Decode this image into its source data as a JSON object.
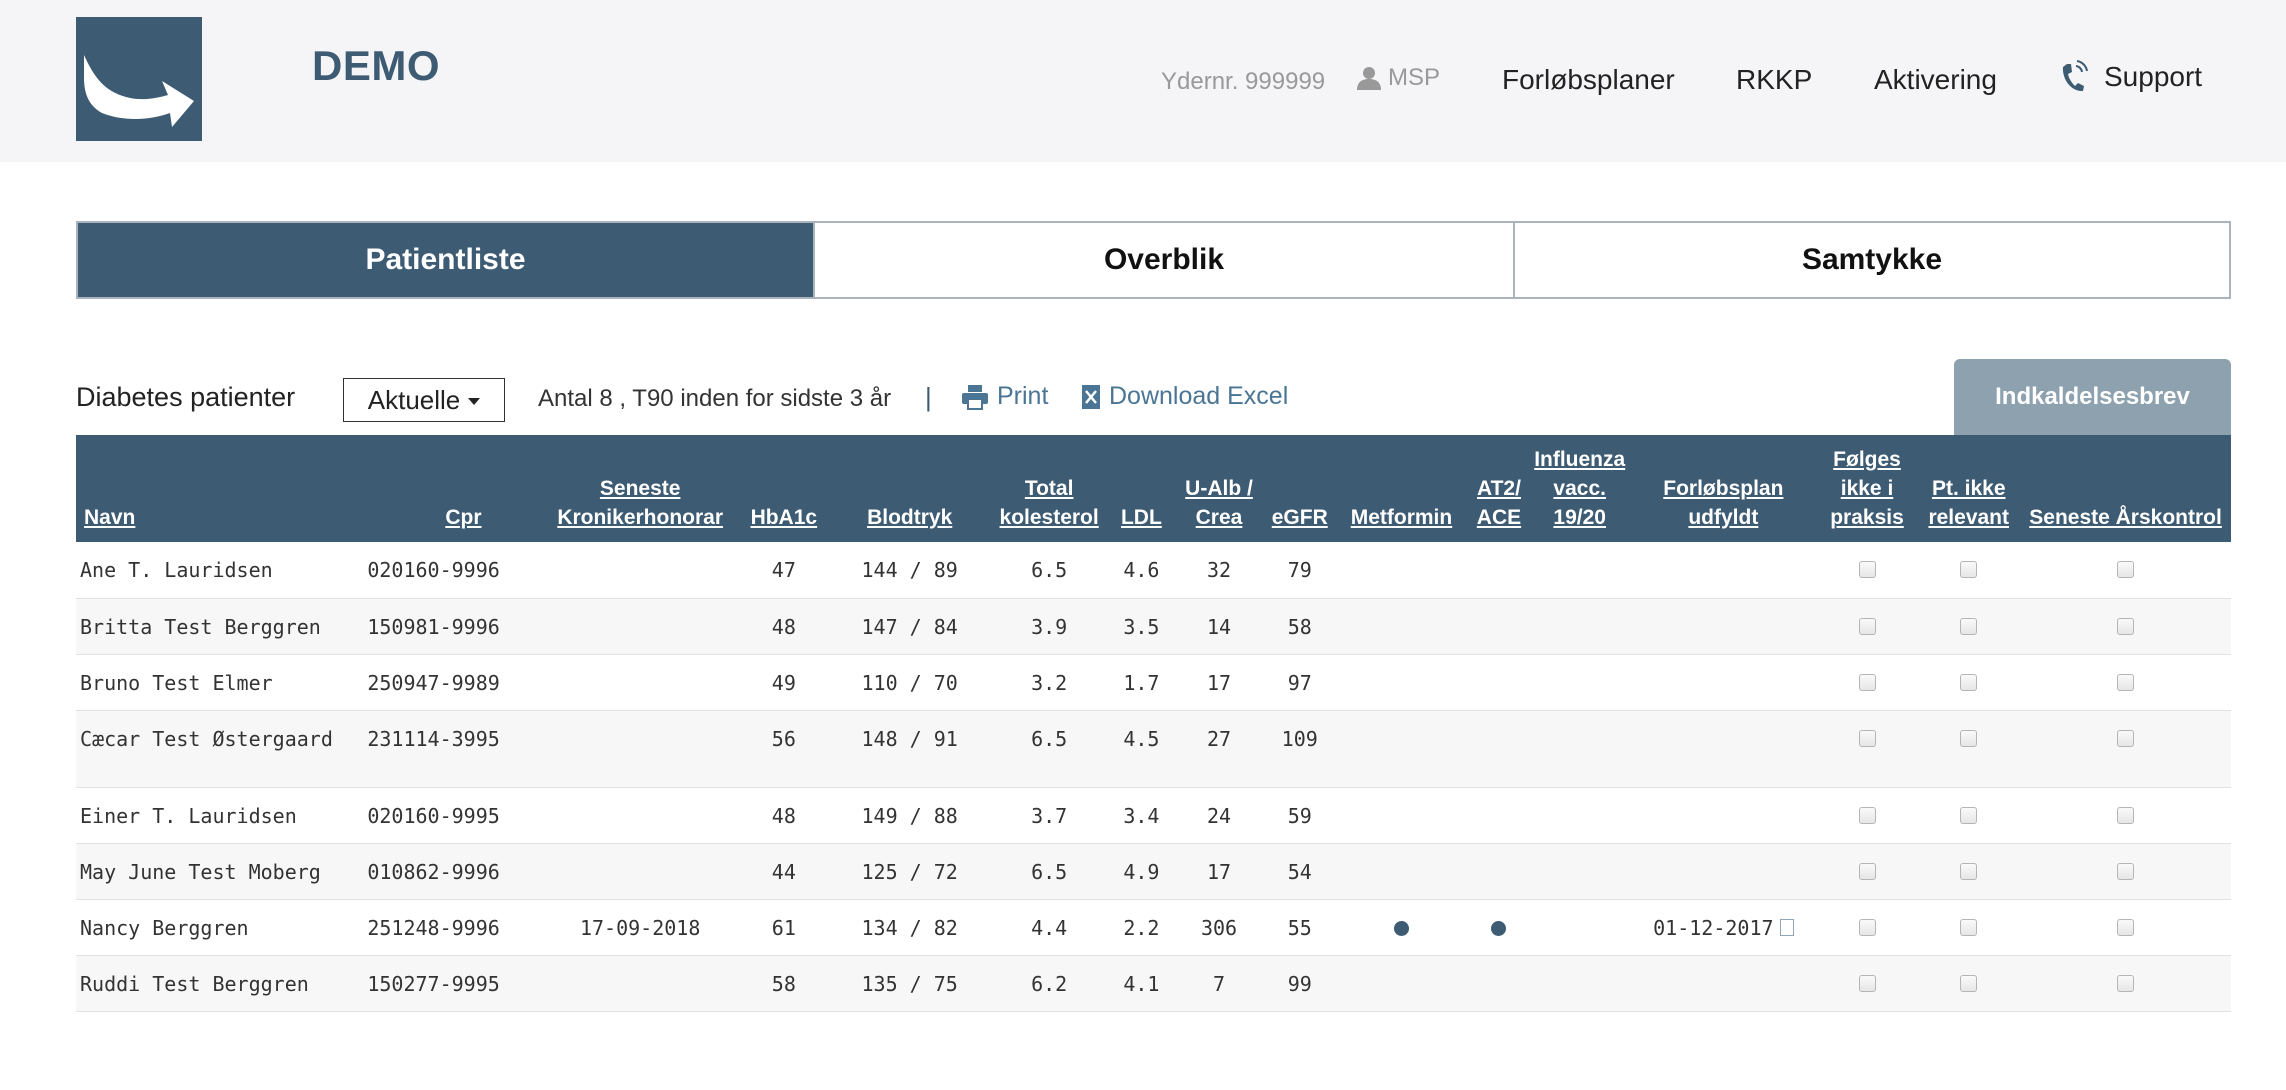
{
  "header": {
    "brand": "DEMO",
    "ydernr": "Ydernr. 999999",
    "user": "MSP",
    "nav": [
      "Forløbsplaner",
      "RKKP",
      "Aktivering"
    ],
    "support": "Support"
  },
  "tabs": [
    "Patientliste",
    "Overblik",
    "Samtykke"
  ],
  "toolbar": {
    "label": "Diabetes patienter",
    "filter_value": "Aktuelle",
    "count_text": "Antal 8 , T90 inden for sidste 3 år",
    "separator": "|",
    "print": "Print",
    "excel": "Download Excel",
    "letter_button": "Indkaldelsesbrev"
  },
  "table": {
    "headers": [
      "Navn",
      "Cpr",
      "Seneste Kronikerhonorar",
      "HbA1c",
      "Blodtryk",
      "Total kolesterol",
      "LDL",
      "U-Alb / Crea",
      "eGFR",
      "Metformin",
      "AT2/ ACE",
      "Influenza vacc. 19/20",
      "Forløbsplan udfyldt",
      "Følges ikke i praksis",
      "Pt. ikke relevant",
      "Seneste Årskontrol"
    ],
    "rows": [
      {
        "navn": "Ane T. Lauridsen",
        "cpr": "020160-9996",
        "honorar": "",
        "hba1c": "47",
        "blodtryk": "144 / 89",
        "kolesterol": "6.5",
        "ldl": "4.6",
        "ualb": "32",
        "egfr": "79",
        "metformin": false,
        "at2": false,
        "influenza": "",
        "plan": ""
      },
      {
        "navn": "Britta Test Berggren",
        "cpr": "150981-9996",
        "honorar": "",
        "hba1c": "48",
        "blodtryk": "147 / 84",
        "kolesterol": "3.9",
        "ldl": "3.5",
        "ualb": "14",
        "egfr": "58",
        "metformin": false,
        "at2": false,
        "influenza": "",
        "plan": ""
      },
      {
        "navn": "Bruno Test Elmer",
        "cpr": "250947-9989",
        "honorar": "",
        "hba1c": "49",
        "blodtryk": "110 / 70",
        "kolesterol": "3.2",
        "ldl": "1.7",
        "ualb": "17",
        "egfr": "97",
        "metformin": false,
        "at2": false,
        "influenza": "",
        "plan": ""
      },
      {
        "navn": "Cæcar Test Østergaard",
        "cpr": "231114-3995",
        "honorar": "",
        "hba1c": "56",
        "blodtryk": "148 / 91",
        "kolesterol": "6.5",
        "ldl": "4.5",
        "ualb": "27",
        "egfr": "109",
        "metformin": false,
        "at2": false,
        "influenza": "",
        "plan": ""
      },
      {
        "navn": "Einer T. Lauridsen",
        "cpr": "020160-9995",
        "honorar": "",
        "hba1c": "48",
        "blodtryk": "149 / 88",
        "kolesterol": "3.7",
        "ldl": "3.4",
        "ualb": "24",
        "egfr": "59",
        "metformin": false,
        "at2": false,
        "influenza": "",
        "plan": ""
      },
      {
        "navn": "May June Test Moberg",
        "cpr": "010862-9996",
        "honorar": "",
        "hba1c": "44",
        "blodtryk": "125 / 72",
        "kolesterol": "6.5",
        "ldl": "4.9",
        "ualb": "17",
        "egfr": "54",
        "metformin": false,
        "at2": false,
        "influenza": "",
        "plan": ""
      },
      {
        "navn": "Nancy Berggren",
        "cpr": "251248-9996",
        "honorar": "17-09-2018",
        "hba1c": "61",
        "blodtryk": "134 / 82",
        "kolesterol": "4.4",
        "ldl": "2.2",
        "ualb": "306",
        "egfr": "55",
        "metformin": true,
        "at2": true,
        "influenza": "",
        "plan": "01-12-2017"
      },
      {
        "navn": "Ruddi Test Berggren",
        "cpr": "150277-9995",
        "honorar": "",
        "hba1c": "58",
        "blodtryk": "135 / 75",
        "kolesterol": "6.2",
        "ldl": "4.1",
        "ualb": "7",
        "egfr": "99",
        "metformin": false,
        "at2": false,
        "influenza": "",
        "plan": ""
      }
    ]
  },
  "colors": {
    "primary": "#3d5b73",
    "link": "#4a7594",
    "button_disabled": "#8ea1ae"
  }
}
